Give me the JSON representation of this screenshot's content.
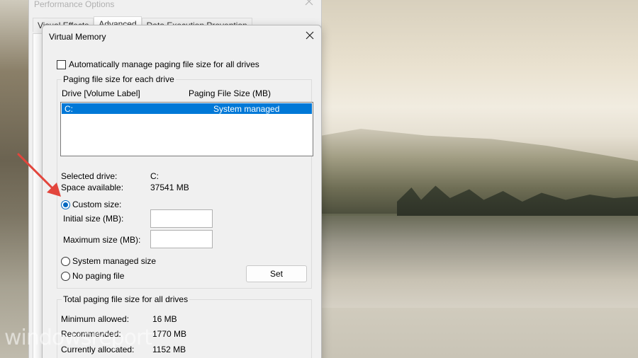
{
  "watermark": "windowsreport",
  "performance_options": {
    "title": "Performance Options",
    "tabs": [
      {
        "label": "Visual Effects"
      },
      {
        "label": "Advanced"
      },
      {
        "label": "Data Execution Prevention"
      }
    ]
  },
  "virtual_memory": {
    "title": "Virtual Memory",
    "auto_manage_label": "Automatically manage paging file size for all drives",
    "auto_manage_checked": false,
    "paging_group": {
      "label": "Paging file size for each drive",
      "col_drive": "Drive  [Volume Label]",
      "col_size": "Paging File Size (MB)",
      "rows": [
        {
          "drive": "C:",
          "size": "System managed"
        }
      ],
      "selected_drive_label": "Selected drive:",
      "selected_drive_value": "C:",
      "space_label": "Space available:",
      "space_value": "37541 MB",
      "custom_size_label": "Custom size:",
      "initial_size_label": "Initial size (MB):",
      "initial_size_value": "",
      "maximum_size_label": "Maximum size (MB):",
      "maximum_size_value": "",
      "system_managed_label": "System managed size",
      "no_paging_label": "No paging file",
      "selected_option": "custom",
      "set_label": "Set"
    },
    "total_group": {
      "label": "Total paging file size for all drives",
      "minimum_label": "Minimum allowed:",
      "minimum_value": "16 MB",
      "recommended_label": "Recommended:",
      "recommended_value": "1770 MB",
      "allocated_label": "Currently allocated:",
      "allocated_value": "1152 MB"
    }
  },
  "colors": {
    "selection": "#0078d7",
    "radio_accent": "#0067c0",
    "annotation_arrow": "#e2453c"
  }
}
